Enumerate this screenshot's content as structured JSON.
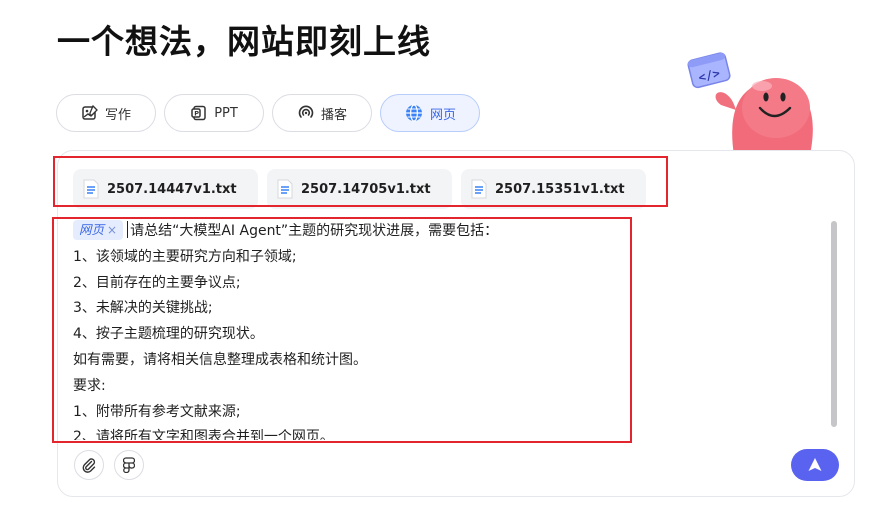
{
  "page": {
    "title": "一个想法，网站即刻上线"
  },
  "tabs": [
    {
      "label": "写作",
      "icon": "pen-image-icon",
      "active": false
    },
    {
      "label": "PPT",
      "icon": "ppt-icon",
      "active": false
    },
    {
      "label": "播客",
      "icon": "podcast-icon",
      "active": false
    },
    {
      "label": "网页",
      "icon": "globe-icon",
      "active": true
    }
  ],
  "files": [
    {
      "name": "2507.14447v1.txt",
      "icon": "text-file-icon"
    },
    {
      "name": "2507.14705v1.txt",
      "icon": "text-file-icon"
    },
    {
      "name": "2507.15351v1.txt",
      "icon": "text-file-icon"
    }
  ],
  "editor": {
    "chip_label": "网页",
    "chip_close": "×",
    "lines": [
      "请总结“大模型AI Agent”主题的研究现状进展，需要包括：",
      "1、该领域的主要研究方向和子领域;",
      "2、目前存在的主要争议点;",
      "3、未解决的关键挑战;",
      "4、按子主题梳理的研究现状。",
      "如有需要，请将相关信息整理成表格和统计图。",
      "要求:",
      "1、附带所有参考文献来源;",
      "2、请将所有文字和图表合并到一个网页。"
    ]
  },
  "toolbar": {
    "attach_icon": "paperclip-icon",
    "figma_icon": "figma-icon",
    "send_icon": "send-arrow-icon"
  },
  "colors": {
    "accent": "#5a63f0",
    "active_tab_bg": "#eef3ff",
    "active_tab_text": "#3b66e6",
    "highlight_box": "#e3262d",
    "mascot": "#f06c7a"
  }
}
